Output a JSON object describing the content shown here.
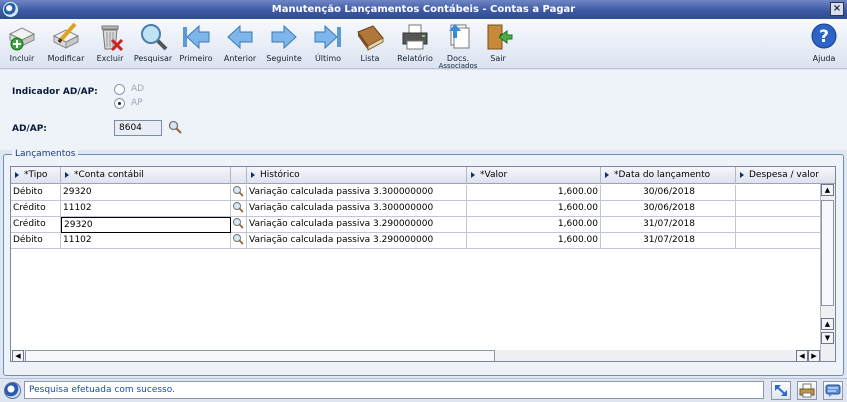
{
  "window": {
    "title": "Manutenção Lançamentos Contábeis - Contas a Pagar",
    "close_label": "×"
  },
  "toolbar": {
    "items": [
      {
        "label": "Incluir",
        "icon": "add-document-icon"
      },
      {
        "label": "Modificar",
        "icon": "edit-document-icon"
      },
      {
        "label": "Excluir",
        "icon": "trash-delete-icon"
      },
      {
        "label": "Pesquisar",
        "icon": "magnifier-icon"
      },
      {
        "label": "Primeiro",
        "icon": "first-arrow-icon"
      },
      {
        "label": "Anterior",
        "icon": "previous-arrow-icon"
      },
      {
        "label": "Seguinte",
        "icon": "next-arrow-icon"
      },
      {
        "label": "Último",
        "icon": "last-arrow-icon"
      },
      {
        "label": "Lista",
        "icon": "book-list-icon"
      },
      {
        "label": "Relatório",
        "icon": "printer-icon"
      },
      {
        "label": "Docs.",
        "label2": "Associados",
        "icon": "associated-docs-icon"
      },
      {
        "label": "Sair",
        "icon": "exit-door-icon"
      },
      {
        "label": "Ajuda",
        "icon": "help-icon"
      }
    ]
  },
  "form": {
    "indicador_label": "Indicador AD/AP:",
    "radio_ad": "AD",
    "radio_ap": "AP",
    "adap_label": "AD/AP:",
    "adap_value": "8604"
  },
  "group": {
    "legend": "Lançamentos"
  },
  "grid": {
    "headers": [
      "*Tipo",
      "*Conta contábil",
      "",
      "Histórico",
      "*Valor",
      "*Data do lançamento",
      "Despesa / valor"
    ],
    "rows": [
      {
        "tipo": "Débito",
        "conta": "29320",
        "historico": "Variação calculada passiva 3.300000000",
        "valor": "1,600.00",
        "data": "30/06/2018",
        "despesa": ""
      },
      {
        "tipo": "Crédito",
        "conta": "11102",
        "historico": "Variação calculada passiva 3.300000000",
        "valor": "1,600.00",
        "data": "30/06/2018",
        "despesa": ""
      },
      {
        "tipo": "Crédito",
        "conta": "29320",
        "historico": "Variação calculada passiva 3.290000000",
        "valor": "1,600.00",
        "data": "31/07/2018",
        "despesa": ""
      },
      {
        "tipo": "Débito",
        "conta": "11102",
        "historico": "Variação calculada passiva 3.290000000",
        "valor": "1,600.00",
        "data": "31/07/2018",
        "despesa": ""
      }
    ]
  },
  "status": {
    "message": "Pesquisa efetuada com sucesso."
  },
  "colors": {
    "titlebar": "#3e5aa3",
    "status_text": "#1a4ab0",
    "legend": "#183b8c"
  }
}
